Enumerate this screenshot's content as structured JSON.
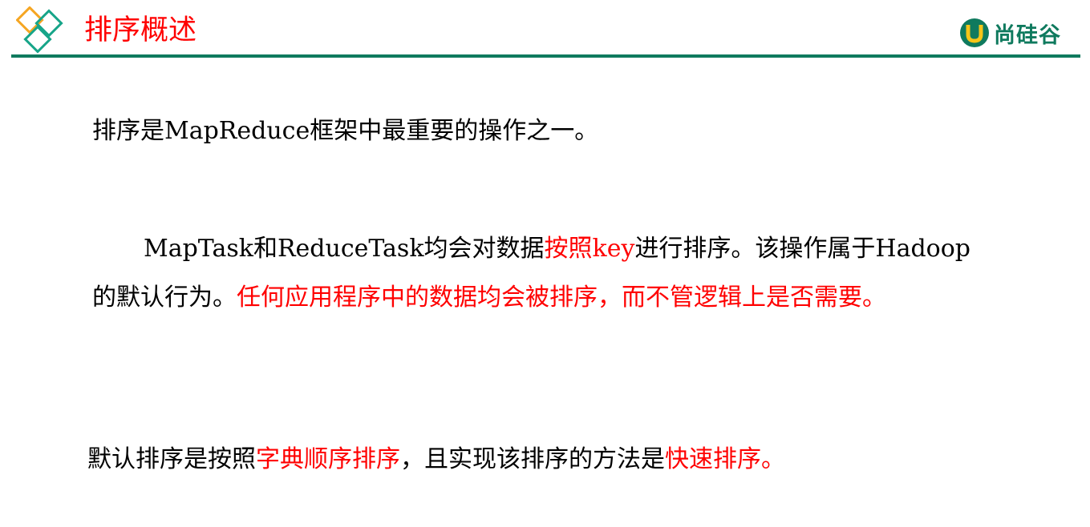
{
  "header": {
    "title": "排序概述",
    "brand_name": "尚硅谷",
    "colors": {
      "accent": "#ff0000",
      "brand_green": "#0f7a5e",
      "diamond_orange": "#f5a623",
      "diamond_green": "#17a589"
    }
  },
  "content": {
    "p1": "排序是MapReduce框架中最重要的操作之一。",
    "p2": {
      "seg1": "MapTask和ReduceTask均会对数据",
      "seg2": "按照key",
      "seg3": "进行排序。该操作属于Hadoop的默认行为。",
      "seg4": "任何应用程序中的数据均会被排序，而不管逻辑上是否需要。"
    },
    "p3": {
      "seg1": "默认排序是按照",
      "seg2": "字典顺序排序",
      "seg3": "，且实现该排序的方法是",
      "seg4": "快速排序",
      "seg5": "。"
    }
  }
}
